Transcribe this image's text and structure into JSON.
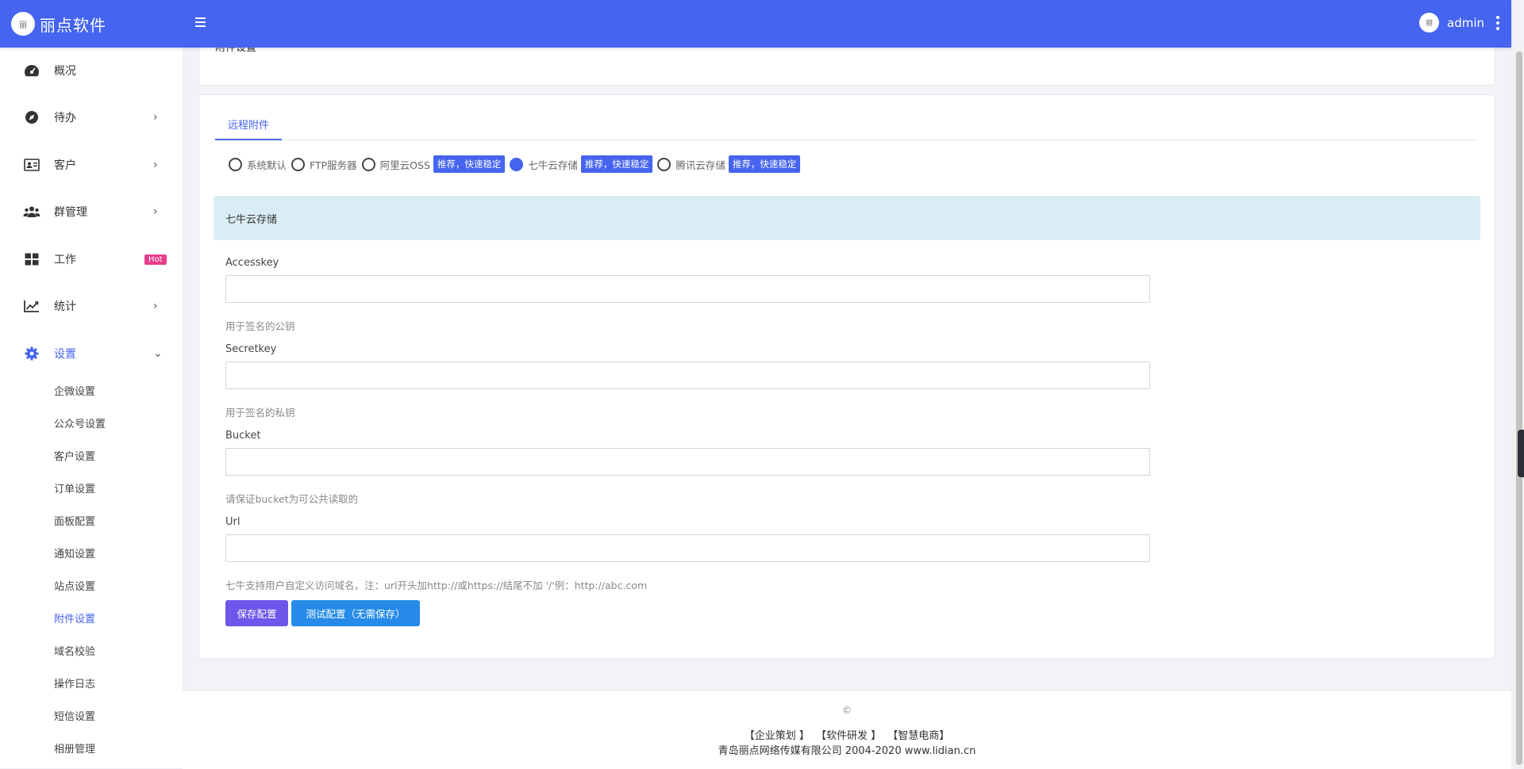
{
  "app": {
    "brand_name": "丽点软件",
    "logo_text": "丽",
    "user_name": "admin",
    "avatar_text": "丽"
  },
  "sidebar": {
    "items": [
      {
        "label": "概况",
        "icon": "dashboard-icon"
      },
      {
        "label": "待办",
        "icon": "compass-icon",
        "arrow": "›"
      },
      {
        "label": "客户",
        "icon": "id-card-icon",
        "arrow": "›"
      },
      {
        "label": "群管理",
        "icon": "users-icon",
        "arrow": "›"
      },
      {
        "label": "工作",
        "icon": "grid-icon",
        "badge": "Hot"
      },
      {
        "label": "统计",
        "icon": "chart-line-icon",
        "arrow": "›"
      },
      {
        "label": "设置",
        "icon": "gear-icon",
        "arrow": "⌄"
      }
    ],
    "sub_items": [
      "企微设置",
      "公众号设置",
      "客户设置",
      "订单设置",
      "面板配置",
      "通知设置",
      "站点设置",
      "附件设置",
      "域名校验",
      "操作日志",
      "短信设置",
      "相册管理"
    ]
  },
  "top_card": {
    "title": "附件设置"
  },
  "main": {
    "tab": "远程附件",
    "radios": [
      {
        "label": "系统默认",
        "checked": false
      },
      {
        "label": "FTP服务器",
        "checked": false
      },
      {
        "label": "阿里云OSS",
        "checked": false,
        "tag": "推荐，快速稳定"
      },
      {
        "label": "七牛云存储",
        "checked": true,
        "tag": "推荐，快速稳定"
      },
      {
        "label": "腾讯云存储",
        "checked": false,
        "tag": "推荐，快速稳定"
      }
    ],
    "info_box": "七牛云存储",
    "fields": [
      {
        "label": "Accesskey",
        "value": "",
        "help": "用于签名的公钥"
      },
      {
        "label": "Secretkey",
        "value": "",
        "help": "用于签名的私钥"
      },
      {
        "label": "Bucket",
        "value": "",
        "help": "请保证bucket为可公共读取的"
      },
      {
        "label": "Url",
        "value": "",
        "help": "七牛支持用户自定义访问域名。注：url开头加http://或https://结尾不加 '/'例：http://abc.com"
      }
    ],
    "save_button": "保存配置",
    "test_button": "测试配置（无需保存）"
  },
  "footer": {
    "copyright": "©",
    "links": [
      "【企业策划 】",
      "【软件研发 】",
      "【智慧电商】"
    ],
    "company": "青岛丽点网络传媒有限公司 2004-2020 www.lidian.cn"
  },
  "colors": {
    "primary": "#4564f0",
    "info_bg": "#d9edf4",
    "save_btn": "#6f55e9",
    "test_btn": "#268be8",
    "hot_badge": "#e83e8c"
  }
}
